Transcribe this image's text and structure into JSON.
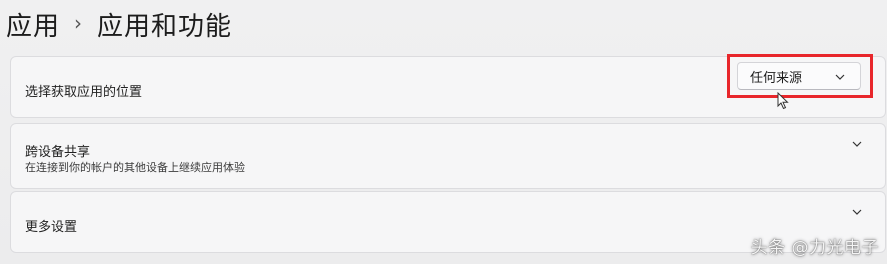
{
  "breadcrumb": {
    "parent": "应用",
    "separator": "›",
    "current": "应用和功能"
  },
  "cards": {
    "install_source": {
      "title": "选择获取应用的位置",
      "dropdown_value": "任何来源"
    },
    "cross_device": {
      "title": "跨设备共享",
      "subtitle": "在连接到你的帐户的其他设备上继续应用体验"
    },
    "more_settings": {
      "title": "更多设置"
    }
  },
  "icons": {
    "dropdown": "chevron-down-icon",
    "expand": "chevron-down-icon",
    "cursor": "mouse-pointer-icon"
  },
  "colors": {
    "highlight": "#e8262b",
    "card_background": "#f6f6f7",
    "page_background": "#eeeeef"
  },
  "watermark": "头条 @力光电子"
}
